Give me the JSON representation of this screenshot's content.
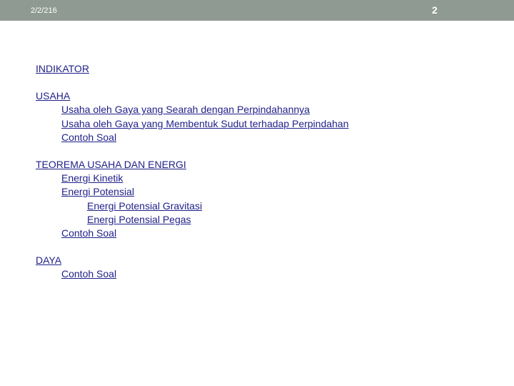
{
  "header": {
    "date": "2/2/216",
    "page_number": "2"
  },
  "toc": {
    "indikator": "INDIKATOR",
    "usaha": "USAHA",
    "usaha_searah": "Usaha oleh Gaya yang Searah dengan Perpindahannya",
    "usaha_sudut": "Usaha oleh Gaya yang Membentuk Sudut terhadap Perpindahan",
    "usaha_contoh": "Contoh Soal",
    "teorema": "TEOREMA USAHA DAN ENERGI",
    "energi_kinetik": "Energi Kinetik",
    "energi_potensial": "Energi Potensial",
    "ep_gravitasi": "Energi Potensial Gravitasi",
    "ep_pegas": "Energi Potensial Pegas",
    "teorema_contoh": "Contoh Soal",
    "daya": "DAYA",
    "daya_contoh": "Contoh Soal"
  }
}
